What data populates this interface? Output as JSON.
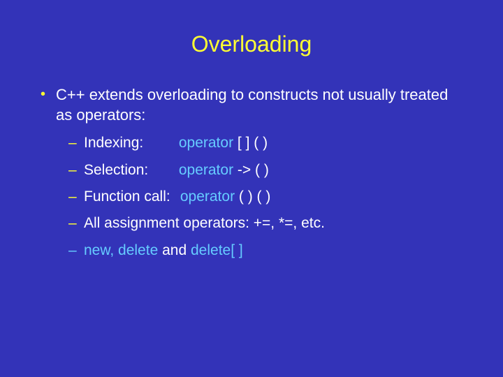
{
  "title": "Overloading",
  "main_bullet": "C++ extends overloading to constructs not usually treated as operators:",
  "items": [
    {
      "label": "Indexing:",
      "keyword": "operator",
      "suffix": " [ ] ( )"
    },
    {
      "label": "Selection:",
      "keyword": "operator",
      "suffix": " -> ( )"
    },
    {
      "label": "Function call:",
      "keyword": "operator",
      "suffix": " ( ) ( )"
    }
  ],
  "plain_item": "All assignment operators: +=, *=, etc.",
  "last_item": {
    "part1": "new, delete",
    "mid": " and ",
    "part2": "delete[ ]"
  }
}
